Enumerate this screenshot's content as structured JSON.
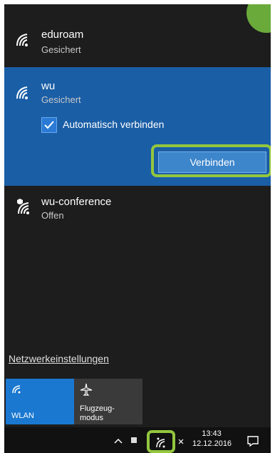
{
  "networks": [
    {
      "ssid": "eduroam",
      "status": "Gesichert"
    },
    {
      "ssid": "wu",
      "status": "Gesichert"
    },
    {
      "ssid": "wu-conference",
      "status": "Offen"
    }
  ],
  "selected": {
    "auto_connect_label": "Automatisch verbinden",
    "auto_connect_checked": true,
    "connect_button": "Verbinden"
  },
  "settings_link": "Netzwerkeinstellungen",
  "quick_actions": [
    {
      "label": "WLAN",
      "icon": "wifi-icon",
      "active": true
    },
    {
      "label_line1": "Flugzeug-",
      "label_line2": "modus",
      "icon": "airplane-icon",
      "active": false
    }
  ],
  "taskbar": {
    "time": "13:43",
    "date": "12.12.2016"
  },
  "colors": {
    "selected_bg": "#1a5ea6",
    "highlight_frame": "#94c63e",
    "panel_bg": "#1d1d1d"
  }
}
